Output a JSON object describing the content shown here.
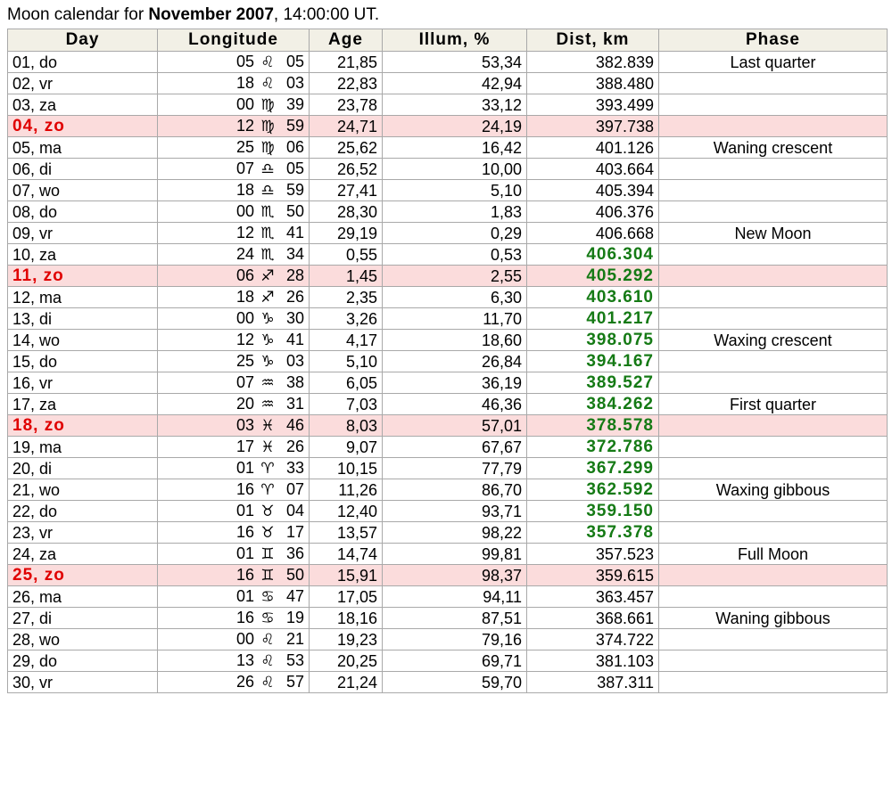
{
  "caption": {
    "prefix": "Moon calendar for ",
    "month": "November 2007",
    "suffix": ", 14:00:00 UT."
  },
  "headers": {
    "day": "Day",
    "longitude": "Longitude",
    "age": "Age",
    "illum": "Illum, %",
    "dist": "Dist, km",
    "phase": "Phase"
  },
  "colors": {
    "sunday_text": "#e00000",
    "sunday_row_bg": "#fbdcdc",
    "near_distance": "#157a15",
    "border": "#a9a9a9"
  },
  "rows": [
    {
      "day": "01, do",
      "deg": "05",
      "sign": "♌",
      "min": "05",
      "age": "21,85",
      "illum": "53,34",
      "dist": "382.839",
      "phase": "Last quarter",
      "sunday": false,
      "near": false
    },
    {
      "day": "02, vr",
      "deg": "18",
      "sign": "♌",
      "min": "03",
      "age": "22,83",
      "illum": "42,94",
      "dist": "388.480",
      "phase": "",
      "sunday": false,
      "near": false
    },
    {
      "day": "03, za",
      "deg": "00",
      "sign": "♍",
      "min": "39",
      "age": "23,78",
      "illum": "33,12",
      "dist": "393.499",
      "phase": "",
      "sunday": false,
      "near": false
    },
    {
      "day": "04, zo",
      "deg": "12",
      "sign": "♍",
      "min": "59",
      "age": "24,71",
      "illum": "24,19",
      "dist": "397.738",
      "phase": "",
      "sunday": true,
      "near": false
    },
    {
      "day": "05, ma",
      "deg": "25",
      "sign": "♍",
      "min": "06",
      "age": "25,62",
      "illum": "16,42",
      "dist": "401.126",
      "phase": "Waning crescent",
      "sunday": false,
      "near": false
    },
    {
      "day": "06, di",
      "deg": "07",
      "sign": "♎",
      "min": "05",
      "age": "26,52",
      "illum": "10,00",
      "dist": "403.664",
      "phase": "",
      "sunday": false,
      "near": false
    },
    {
      "day": "07, wo",
      "deg": "18",
      "sign": "♎",
      "min": "59",
      "age": "27,41",
      "illum": "5,10",
      "dist": "405.394",
      "phase": "",
      "sunday": false,
      "near": false
    },
    {
      "day": "08, do",
      "deg": "00",
      "sign": "♏",
      "min": "50",
      "age": "28,30",
      "illum": "1,83",
      "dist": "406.376",
      "phase": "",
      "sunday": false,
      "near": false
    },
    {
      "day": "09, vr",
      "deg": "12",
      "sign": "♏",
      "min": "41",
      "age": "29,19",
      "illum": "0,29",
      "dist": "406.668",
      "phase": "New Moon",
      "sunday": false,
      "near": false
    },
    {
      "day": "10, za",
      "deg": "24",
      "sign": "♏",
      "min": "34",
      "age": "0,55",
      "illum": "0,53",
      "dist": "406.304",
      "phase": "",
      "sunday": false,
      "near": true
    },
    {
      "day": "11, zo",
      "deg": "06",
      "sign": "♐",
      "min": "28",
      "age": "1,45",
      "illum": "2,55",
      "dist": "405.292",
      "phase": "",
      "sunday": true,
      "near": true
    },
    {
      "day": "12, ma",
      "deg": "18",
      "sign": "♐",
      "min": "26",
      "age": "2,35",
      "illum": "6,30",
      "dist": "403.610",
      "phase": "",
      "sunday": false,
      "near": true
    },
    {
      "day": "13, di",
      "deg": "00",
      "sign": "♑",
      "min": "30",
      "age": "3,26",
      "illum": "11,70",
      "dist": "401.217",
      "phase": "",
      "sunday": false,
      "near": true
    },
    {
      "day": "14, wo",
      "deg": "12",
      "sign": "♑",
      "min": "41",
      "age": "4,17",
      "illum": "18,60",
      "dist": "398.075",
      "phase": "Waxing crescent",
      "sunday": false,
      "near": true
    },
    {
      "day": "15, do",
      "deg": "25",
      "sign": "♑",
      "min": "03",
      "age": "5,10",
      "illum": "26,84",
      "dist": "394.167",
      "phase": "",
      "sunday": false,
      "near": true
    },
    {
      "day": "16, vr",
      "deg": "07",
      "sign": "♒",
      "min": "38",
      "age": "6,05",
      "illum": "36,19",
      "dist": "389.527",
      "phase": "",
      "sunday": false,
      "near": true
    },
    {
      "day": "17, za",
      "deg": "20",
      "sign": "♒",
      "min": "31",
      "age": "7,03",
      "illum": "46,36",
      "dist": "384.262",
      "phase": "First quarter",
      "sunday": false,
      "near": true
    },
    {
      "day": "18, zo",
      "deg": "03",
      "sign": "♓",
      "min": "46",
      "age": "8,03",
      "illum": "57,01",
      "dist": "378.578",
      "phase": "",
      "sunday": true,
      "near": true
    },
    {
      "day": "19, ma",
      "deg": "17",
      "sign": "♓",
      "min": "26",
      "age": "9,07",
      "illum": "67,67",
      "dist": "372.786",
      "phase": "",
      "sunday": false,
      "near": true
    },
    {
      "day": "20, di",
      "deg": "01",
      "sign": "♈",
      "min": "33",
      "age": "10,15",
      "illum": "77,79",
      "dist": "367.299",
      "phase": "",
      "sunday": false,
      "near": true
    },
    {
      "day": "21, wo",
      "deg": "16",
      "sign": "♈",
      "min": "07",
      "age": "11,26",
      "illum": "86,70",
      "dist": "362.592",
      "phase": "Waxing gibbous",
      "sunday": false,
      "near": true
    },
    {
      "day": "22, do",
      "deg": "01",
      "sign": "♉",
      "min": "04",
      "age": "12,40",
      "illum": "93,71",
      "dist": "359.150",
      "phase": "",
      "sunday": false,
      "near": true
    },
    {
      "day": "23, vr",
      "deg": "16",
      "sign": "♉",
      "min": "17",
      "age": "13,57",
      "illum": "98,22",
      "dist": "357.378",
      "phase": "",
      "sunday": false,
      "near": true
    },
    {
      "day": "24, za",
      "deg": "01",
      "sign": "♊",
      "min": "36",
      "age": "14,74",
      "illum": "99,81",
      "dist": "357.523",
      "phase": "Full Moon",
      "sunday": false,
      "near": false
    },
    {
      "day": "25, zo",
      "deg": "16",
      "sign": "♊",
      "min": "50",
      "age": "15,91",
      "illum": "98,37",
      "dist": "359.615",
      "phase": "",
      "sunday": true,
      "near": false
    },
    {
      "day": "26, ma",
      "deg": "01",
      "sign": "♋",
      "min": "47",
      "age": "17,05",
      "illum": "94,11",
      "dist": "363.457",
      "phase": "",
      "sunday": false,
      "near": false
    },
    {
      "day": "27, di",
      "deg": "16",
      "sign": "♋",
      "min": "19",
      "age": "18,16",
      "illum": "87,51",
      "dist": "368.661",
      "phase": "Waning gibbous",
      "sunday": false,
      "near": false
    },
    {
      "day": "28, wo",
      "deg": "00",
      "sign": "♌",
      "min": "21",
      "age": "19,23",
      "illum": "79,16",
      "dist": "374.722",
      "phase": "",
      "sunday": false,
      "near": false
    },
    {
      "day": "29, do",
      "deg": "13",
      "sign": "♌",
      "min": "53",
      "age": "20,25",
      "illum": "69,71",
      "dist": "381.103",
      "phase": "",
      "sunday": false,
      "near": false
    },
    {
      "day": "30, vr",
      "deg": "26",
      "sign": "♌",
      "min": "57",
      "age": "21,24",
      "illum": "59,70",
      "dist": "387.311",
      "phase": "",
      "sunday": false,
      "near": false
    }
  ]
}
